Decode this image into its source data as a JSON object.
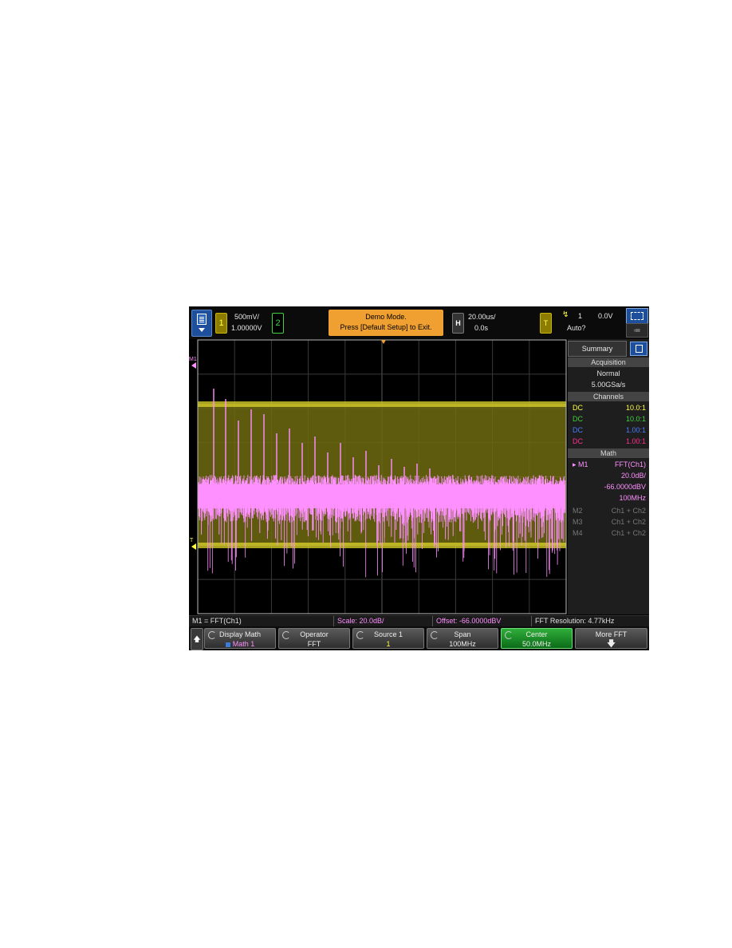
{
  "topbar": {
    "ch1_label": "1",
    "ch1_scale": "500mV/",
    "ch1_offset": "1.00000V",
    "ch2_label": "2",
    "demo_line1": "Demo Mode.",
    "demo_line2": "Press [Default Setup] to Exit.",
    "h_label": "H",
    "time_div": "20.00us/",
    "time_delay": "0.0s",
    "t_label": "T",
    "trig_source": "1",
    "trig_level": "0.0V",
    "trig_mode": "Auto?",
    "trig_icon": "rising-edge-icon",
    "menu_icon": "menu-icon",
    "display_icon": "display-mode-icon"
  },
  "sidebar": {
    "tab_label": "Summary",
    "acquisition": {
      "header": "Acquisition",
      "mode": "Normal",
      "rate": "5.00GSa/s"
    },
    "channels": {
      "header": "Channels",
      "rows": [
        {
          "coupling": "DC",
          "probe": "10.0:1",
          "color": "#ffff40"
        },
        {
          "coupling": "DC",
          "probe": "10.0:1",
          "color": "#3fd33f"
        },
        {
          "coupling": "DC",
          "probe": "1.00:1",
          "color": "#4a7bff"
        },
        {
          "coupling": "DC",
          "probe": "1.00:1",
          "color": "#ff3090"
        }
      ]
    },
    "math": {
      "header": "Math",
      "m1_label": "M1",
      "m1_func": "FFT(Ch1)",
      "m1_scale": "20.0dB/",
      "m1_offset": "-66.0000dBV",
      "m1_span": "100MHz",
      "others": [
        {
          "label": "M2",
          "func": "Ch1 + Ch2"
        },
        {
          "label": "M3",
          "func": "Ch1 + Ch2"
        },
        {
          "label": "M4",
          "func": "Ch1 + Ch2"
        }
      ]
    }
  },
  "status": {
    "func": "M1 = FFT(Ch1)",
    "scale": "Scale: 20.0dB/",
    "offset": "Offset: -66.0000dBV",
    "resolution": "FFT Resolution: 4.77kHz"
  },
  "softkeys": {
    "back_icon": "up-arrow-icon",
    "keys": [
      {
        "title": "Display Math",
        "value": "Math 1"
      },
      {
        "title": "Operator",
        "value": "FFT"
      },
      {
        "title": "Source 1",
        "value": "1"
      },
      {
        "title": "Span",
        "value": "100MHz"
      },
      {
        "title": "Center",
        "value": "50.0MHz"
      },
      {
        "title": "More FFT",
        "value": ""
      }
    ]
  },
  "colors": {
    "channel1": "#ffff40",
    "channel2": "#3fd33f",
    "math": "#ff90ff",
    "demo_banner": "#f0a030",
    "active_key": "#1f9a2c"
  },
  "markers": {
    "m1": "M1",
    "t": "T"
  }
}
